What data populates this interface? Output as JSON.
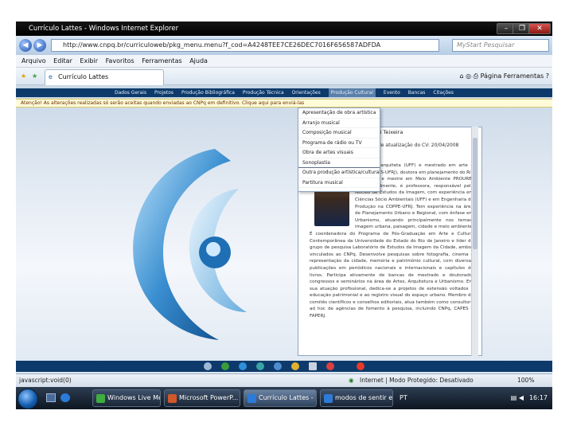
{
  "window": {
    "title": "Currículo Lattes - Windows Internet Explorer",
    "min": "–",
    "restore": "❐",
    "close": "✕"
  },
  "address": {
    "back": "◀",
    "forward": "▶",
    "url": "http://www.cnpq.br/curriculoweb/pkg_menu.menu?f_cod=A4248TEE7CE26DEC7016F656587ADFDA",
    "search_placeholder": "MyStart Pesquisar"
  },
  "menu": [
    "Arquivo",
    "Editar",
    "Exibir",
    "Favoritos",
    "Ferramentas",
    "Ajuda"
  ],
  "favorites": {
    "tab_title": "Currículo Lattes",
    "page_menu": "Página",
    "tools_menu": "Ferramentas"
  },
  "lattes_nav": {
    "items": [
      "Dados Gerais",
      "Projetos",
      "Produção Bibliográfica",
      "Produção Técnica",
      "Orientações",
      "Produção Cultural",
      "Evento",
      "Bancas",
      "Citações"
    ],
    "active_index": 5
  },
  "alert": "Atenção! As alterações realizadas só serão aceitas quando enviadas ao CNPq em definitivo. Clique aqui para enviá-las",
  "dropdown": {
    "items": [
      "Apresentação de obra artística",
      "Arranjo musical",
      "Composição musical",
      "Programa de rádio ou TV",
      "Obra de artes visuais",
      "Sonoplastia",
      "Outra produção artística/cultural",
      "Partitura musical"
    ],
    "separator_after": 5
  },
  "panel": {
    "name": "ri Teixeira",
    "sub": "de atualização do CV: 20/04/2008",
    "bio": "Teixeira é arquiteta (UFF) e mestrado em arte e cultura (IFCS-UFRJ), doutora em planejamento do Rio de Janeiro e mestre em Meio Ambiente PROURB-UFRJ. Atualmente, é professora, responsável pelo Núcleo de Estudos da Imagem, com experiência em Ciências Sócio Ambientais (UFF) e em Engenharia de Produção na COPPE-UFRJ. Tem experiência na área de Planejamento Urbano e Regional, com ênfase em Urbanismo, atuando principalmente nos temas: imagem urbana, paisagem, cidade e meio ambiente. É coordenadora do Programa de Pós-Graduação em Arte e Cultura Contemporânea da Universidade do Estado do Rio de Janeiro e líder do grupo de pesquisa Laboratório de Estudos da Imagem da Cidade, ambos vinculados ao CNPq. Desenvolve pesquisas sobre fotografia, cinema e representação da cidade, memória e patrimônio cultural, com diversas publicações em periódicos nacionais e internacionais e capítulos de livros. Participa ativamente de bancas de mestrado e doutorado, congressos e seminários na área de Artes, Arquitetura e Urbanismo. Em sua atuação profissional, dedica-se a projetos de extensão voltados à educação patrimonial e ao registro visual do espaço urbano. Membro de comitês científicos e conselhos editoriais, atua também como consultora ad hoc de agências de fomento à pesquisa, incluindo CNPq, CAPES e FAPERJ."
  },
  "statusbar": {
    "left": "javascript:void(0)",
    "zone": "Internet | Modo Protegido: Desativado",
    "zoom": "100%"
  },
  "taskbar": {
    "tasks": [
      "Windows Live Mes...",
      "Microsoft PowerP...",
      "Currículo Lattes - ...",
      "modos de sentir e ..."
    ],
    "active_index": 2,
    "tray": "PT",
    "clock": "16:17"
  }
}
